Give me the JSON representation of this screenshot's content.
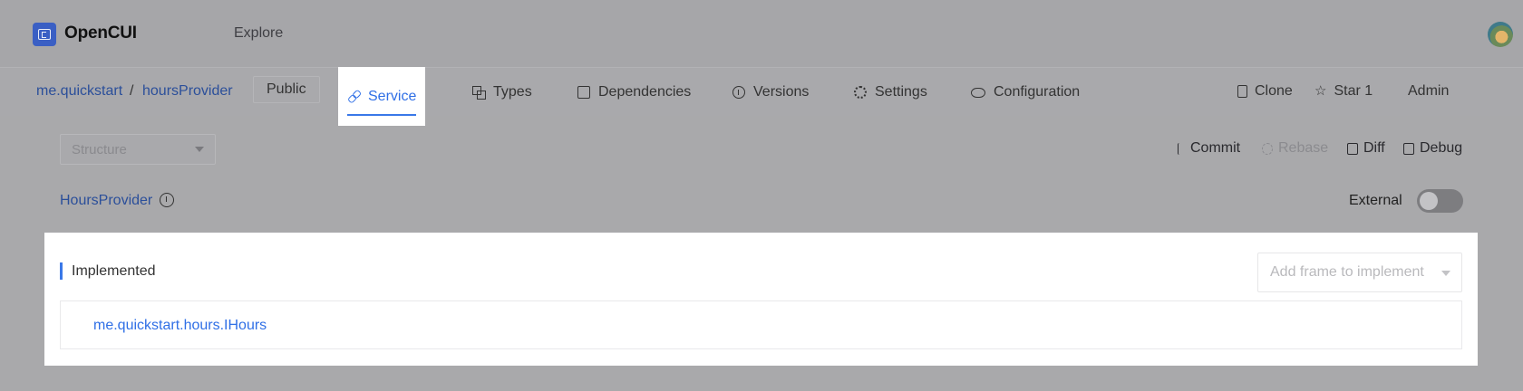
{
  "header": {
    "app_name": "OpenCUI",
    "explore_label": "Explore",
    "logo_icon": "opencui-logo-icon",
    "avatar_icon": "user-avatar"
  },
  "project": {
    "org": "me.quickstart",
    "separator": "/",
    "name": "hoursProvider",
    "visibility": "Public"
  },
  "tabs": [
    {
      "label": "Service",
      "icon": "link-icon",
      "active": true
    },
    {
      "label": "Types",
      "icon": "types-icon",
      "active": false
    },
    {
      "label": "Dependencies",
      "icon": "document-icon",
      "active": false
    },
    {
      "label": "Versions",
      "icon": "info-icon",
      "active": false
    },
    {
      "label": "Settings",
      "icon": "gear-icon",
      "active": false
    },
    {
      "label": "Configuration",
      "icon": "eye-icon",
      "active": false
    }
  ],
  "project_actions": {
    "clone": "Clone",
    "star": "Star 1",
    "admin": "Admin"
  },
  "toolbar": {
    "structure_placeholder": "Structure",
    "commit": "Commit",
    "rebase": "Rebase",
    "diff": "Diff",
    "debug": "Debug"
  },
  "service": {
    "title": "HoursProvider",
    "external_label": "External",
    "external_enabled": false
  },
  "implemented": {
    "section_title": "Implemented",
    "add_frame_placeholder": "Add frame to implement",
    "items": [
      "me.quickstart.hours.IHours"
    ]
  },
  "colors": {
    "accent": "#2f6fe6",
    "overlay_bg": "#a9a9ab"
  }
}
